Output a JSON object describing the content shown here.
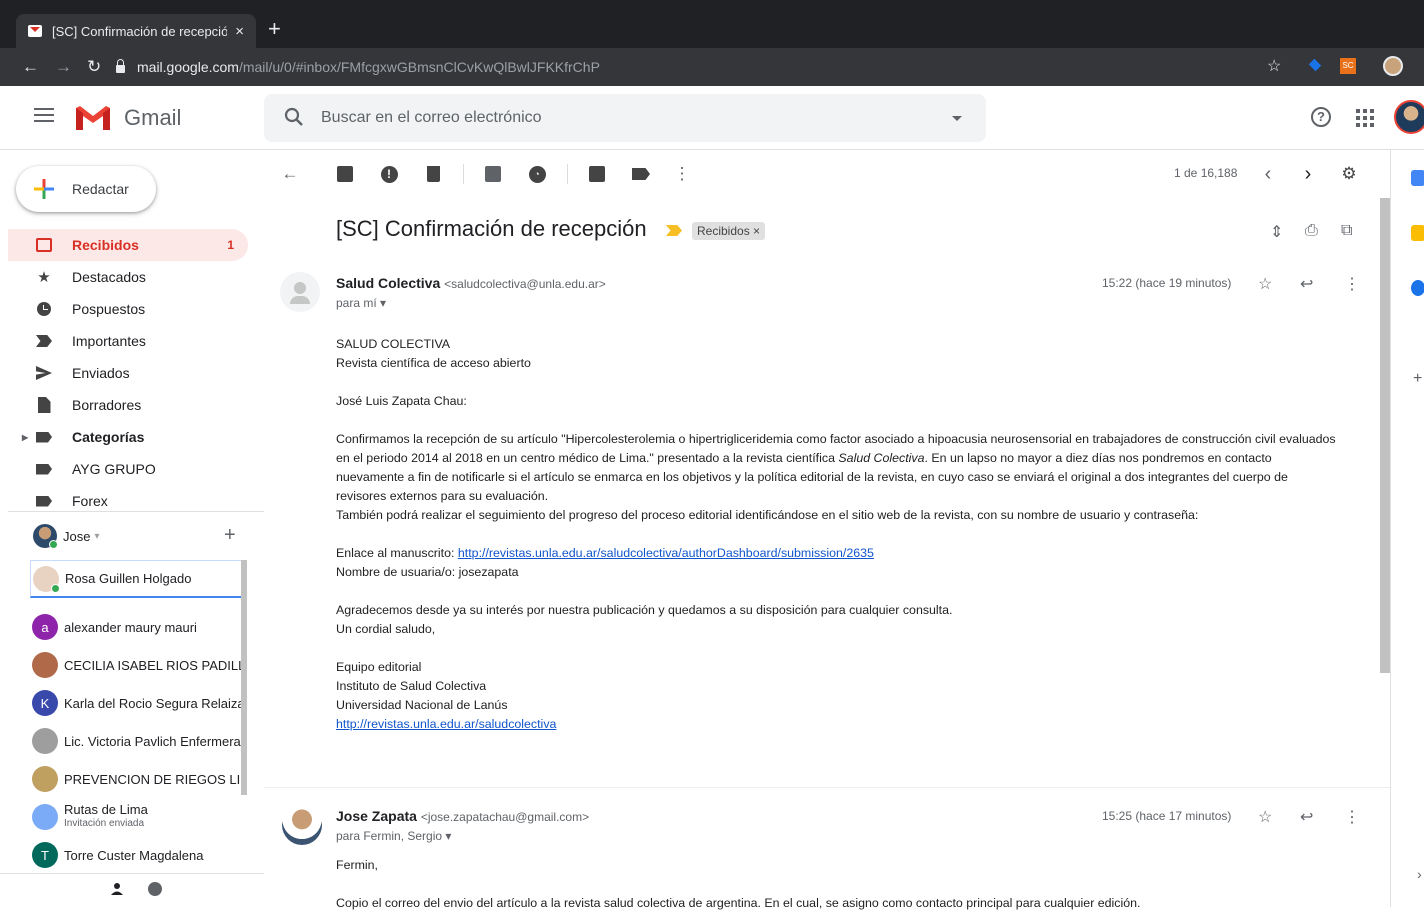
{
  "browser": {
    "tab_title": "[SC] Confirmación de recepción",
    "tab_close": "×",
    "new_tab": "+",
    "url_host": "mail.google.com",
    "url_path": "/mail/u/0/#inbox/FMfcgxwGBmsnClCvKwQlBwlJFKKfrChP",
    "ext_sc": "SC"
  },
  "header": {
    "app_name": "Gmail",
    "search_placeholder": "Buscar en el correo electrónico",
    "help": "?"
  },
  "sidebar": {
    "compose": "Redactar",
    "items": [
      {
        "label": "Recibidos",
        "count": "1"
      },
      {
        "label": "Destacados"
      },
      {
        "label": "Pospuestos"
      },
      {
        "label": "Importantes"
      },
      {
        "label": "Enviados"
      },
      {
        "label": "Borradores"
      },
      {
        "label": "Categorías"
      },
      {
        "label": "AYG GRUPO"
      },
      {
        "label": "Forex"
      }
    ]
  },
  "hangouts": {
    "me": "Jose",
    "add": "+",
    "contacts": [
      {
        "name": "Rosa Guillen Holgado",
        "avatar_color": "#e8d3c3"
      },
      {
        "name": "alexander maury mauri",
        "initial": "a",
        "avatar_color": "#8e24aa"
      },
      {
        "name": "CECILIA ISABEL RIOS PADILLA",
        "avatar_color": "#b06a4a"
      },
      {
        "name": "Karla del Rocio Segura Relaiza",
        "initial": "K",
        "avatar_color": "#3949ab"
      },
      {
        "name": "Lic. Victoria Pavlich Enfermera",
        "avatar_color": "#9e9e9e"
      },
      {
        "name": "PREVENCION DE RIEGOS LIMA",
        "avatar_color": "#c0a060"
      },
      {
        "name": "Rutas de Lima",
        "sub": "Invitación enviada",
        "avatar_color": "#7baaf7"
      },
      {
        "name": "Torre Custer Magdalena",
        "initial": "T",
        "avatar_color": "#00695c"
      }
    ]
  },
  "toolbar": {
    "page_count": "1 de 16,188",
    "prev": "‹",
    "next": "›"
  },
  "thread": {
    "subject": "[SC] Confirmación de recepción",
    "label_chip": "Recibidos ×"
  },
  "message1": {
    "sender_name": "Salud Colectiva",
    "sender_addr": "<saludcolectiva@unla.edu.ar>",
    "to": "para mí ▾",
    "time": "15:22 (hace 19 minutos)",
    "lines": {
      "l1": "SALUD COLECTIVA",
      "l2": "Revista científica de acceso abierto",
      "greeting": "José Luis Zapata Chau:",
      "p1a": "Confirmamos la recepción de su artículo \"Hipercolesterolemia o hipertrigliceridemia como factor asociado a hipoacusia neurosensorial en trabajadores de construcción civil evaluados en el periodo 2014 al 2018 en un centro médico de Lima.\" presentado a la revista científica ",
      "p1_italic": "Salud Colectiva",
      "p1b": ". En un lapso no mayor a diez días nos pondremos en contacto nuevamente a fin de notificarle si el artículo se enmarca en los objetivos y la política editorial de la revista, en cuyo caso se enviará el original a dos integrantes del cuerpo de revisores externos para su evaluación.",
      "p2": "También podrá realizar el seguimiento del progreso del proceso editorial identificándose en el sitio web de la revista, con su nombre de usuario y contraseña:",
      "link_label": "Enlace al manuscrito: ",
      "link_url": "http://revistas.unla.edu.ar/saludcolectiva/authorDashboard/submission/2635",
      "user": "Nombre de usuaria/o: josezapata",
      "thanks": "Agradecemos desde ya su interés por nuestra publicación y quedamos a su disposición para cualquier consulta.",
      "regards": "Un cordial saludo,",
      "sig1": "Equipo editorial",
      "sig2": "Instituto de Salud Colectiva",
      "sig3": "Universidad Nacional de Lanús",
      "sig_url": "http://revistas.unla.edu.ar/saludcolectiva"
    }
  },
  "message2": {
    "sender_name": "Jose Zapata",
    "sender_addr": "<jose.zapatachau@gmail.com>",
    "to": "para Fermin, Sergio ▾",
    "time": "15:25 (hace 17 minutos)",
    "greeting": "Fermin,",
    "line1": "Copio el correo del envio del artículo a la revista salud colectiva de argentina. En el cual, se asigno como contacto principal para cualquier edición."
  }
}
